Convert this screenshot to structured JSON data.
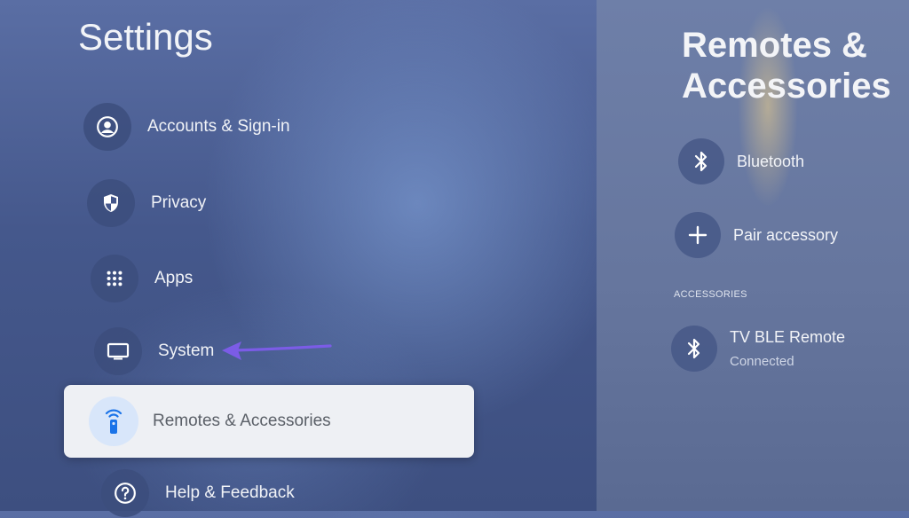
{
  "page": {
    "title": "Settings"
  },
  "menu": {
    "items": [
      {
        "label": "Accounts & Sign-in",
        "icon": "account-circle-icon"
      },
      {
        "label": "Privacy",
        "icon": "shield-icon"
      },
      {
        "label": "Apps",
        "icon": "apps-grid-icon"
      },
      {
        "label": "System",
        "icon": "tv-monitor-icon"
      },
      {
        "label": "Remotes & Accessories",
        "icon": "remote-icon",
        "selected": true
      },
      {
        "label": "Help & Feedback",
        "icon": "help-icon"
      }
    ]
  },
  "panel": {
    "title": "Remotes & Accessories",
    "actions": [
      {
        "label": "Bluetooth",
        "icon": "bluetooth-icon"
      },
      {
        "label": "Pair accessory",
        "icon": "plus-icon"
      }
    ],
    "section_label": "ACCESSORIES",
    "devices": [
      {
        "name": "TV BLE Remote",
        "status": "Connected",
        "icon": "bluetooth-icon"
      }
    ]
  },
  "colors": {
    "selected_card": "#eef0f4",
    "arrow": "#7b5ce6",
    "selected_icon_bg": "#d8e6fa",
    "selected_icon": "#1a73e8"
  }
}
